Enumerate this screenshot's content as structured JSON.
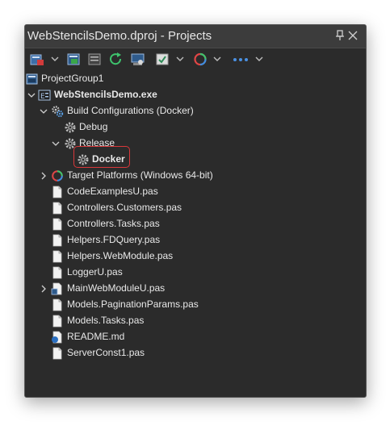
{
  "window": {
    "title": "WebStencilsDemo.dproj - Projects"
  },
  "toolbar": {
    "icons": [
      "new-item-icon",
      "add-file-icon",
      "remove-file-icon",
      "refresh-icon",
      "build-icon",
      "activate-icon",
      "target-platform-icon",
      "more-icon"
    ]
  },
  "tree": {
    "items": [
      {
        "label": "ProjectGroup1",
        "icon": "project-group-icon"
      },
      {
        "label": "WebStencilsDemo.exe",
        "icon": "exe-project-icon"
      },
      {
        "label": "Build Configurations (Docker)",
        "icon": "gears-icon"
      },
      {
        "label": "Debug",
        "icon": "gear-icon"
      },
      {
        "label": "Release",
        "icon": "gear-icon"
      },
      {
        "label": "Docker",
        "icon": "gear-icon"
      },
      {
        "label": "Target Platforms (Windows 64-bit)",
        "icon": "platform-icon"
      },
      {
        "label": "CodeExamplesU.pas",
        "icon": "file-icon"
      },
      {
        "label": "Controllers.Customers.pas",
        "icon": "file-icon"
      },
      {
        "label": "Controllers.Tasks.pas",
        "icon": "file-icon"
      },
      {
        "label": "Helpers.FDQuery.pas",
        "icon": "file-icon"
      },
      {
        "label": "Helpers.WebModule.pas",
        "icon": "file-icon"
      },
      {
        "label": "LoggerU.pas",
        "icon": "file-icon"
      },
      {
        "label": "MainWebModuleU.pas",
        "icon": "webmodule-file-icon"
      },
      {
        "label": "Models.PaginationParams.pas",
        "icon": "file-icon"
      },
      {
        "label": "Models.Tasks.pas",
        "icon": "file-icon"
      },
      {
        "label": "README.md",
        "icon": "markdown-file-icon"
      },
      {
        "label": "ServerConst1.pas",
        "icon": "file-icon"
      }
    ]
  },
  "colors": {
    "panel_bg": "#2b2b2b",
    "title_bg": "#3c3c3c",
    "text": "#e8e8e8",
    "highlight_border": "#d9383a"
  }
}
